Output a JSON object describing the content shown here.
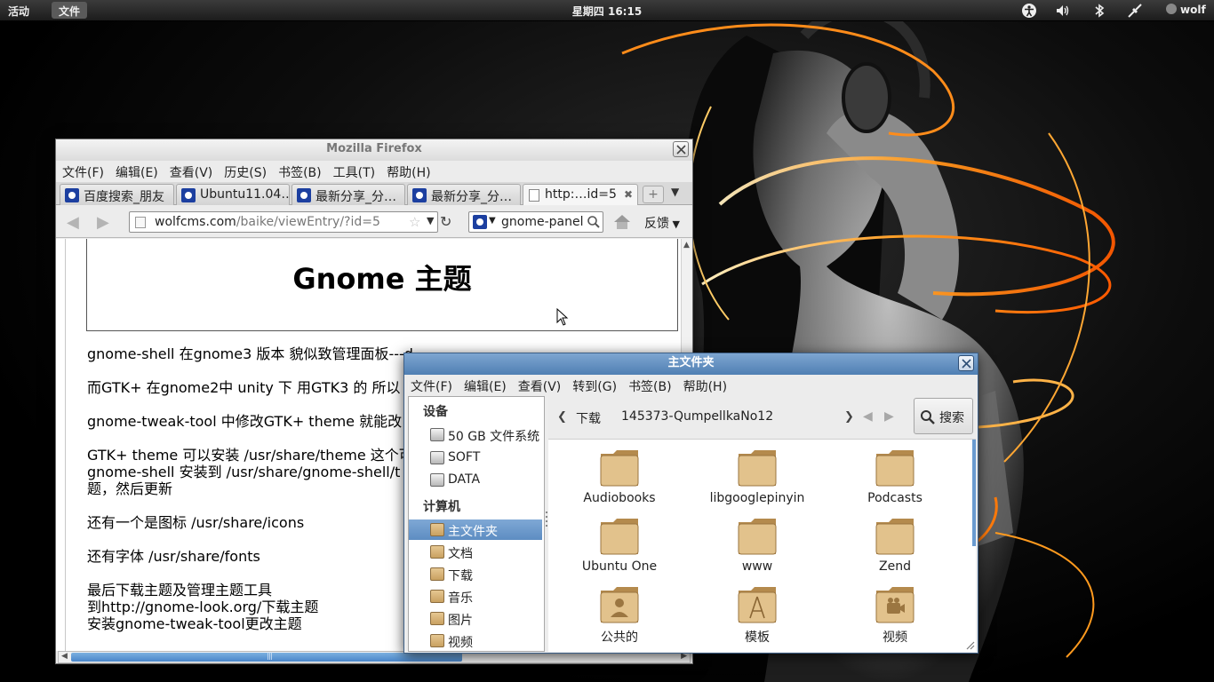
{
  "top_panel": {
    "activities": "活动",
    "app_menu": "文件",
    "clock": "星期四 16:15",
    "user": "wolf",
    "icons": [
      "accessibility-icon",
      "volume-icon",
      "bluetooth-icon",
      "network-icon"
    ]
  },
  "firefox": {
    "title": "Mozilla Firefox",
    "menu": [
      "文件(F)",
      "编辑(E)",
      "查看(V)",
      "历史(S)",
      "书签(B)",
      "工具(T)",
      "帮助(H)"
    ],
    "tabs": [
      {
        "label": "百度搜索_朋友"
      },
      {
        "label": "Ubuntu11.04…"
      },
      {
        "label": "最新分享_分…"
      },
      {
        "label": "最新分享_分…"
      },
      {
        "label": "http:…id=5"
      }
    ],
    "new_tab": "+",
    "url_host": "wolfcms.com",
    "url_path": "/baike/viewEntry/?id=5",
    "search_text": "gnome-panel",
    "feedback_label": "反馈",
    "page_title": "Gnome 主题",
    "paragraphs": [
      "gnome-shell 在gnome3 版本  貌似致管理面板---d",
      "而GTK+ 在gnome2中  unity 下 用GTK3 的 所以",
      "gnome-tweak-tool 中修改GTK+ theme 就能改",
      "GTK+ theme 可以安装 /usr/share/theme 这个可\ngnome-shell 安装到  /usr/share/gnome-shell/t\n题，然后更新",
      "还有一个是图标 /usr/share/icons",
      "还有字体 /usr/share/fonts",
      "最后下载主题及管理主题工具\n到http://gnome-look.org/下载主题\n安装gnome-tweak-tool更改主题"
    ]
  },
  "nautilus": {
    "title": "主文件夹",
    "menu": [
      "文件(F)",
      "编辑(E)",
      "查看(V)",
      "转到(G)",
      "书签(B)",
      "帮助(H)"
    ],
    "sidebar": {
      "devices_header": "设备",
      "devices": [
        "50 GB 文件系统",
        "SOFT",
        "DATA"
      ],
      "computer_header": "计算机",
      "places": [
        "主文件夹",
        "文档",
        "下载",
        "音乐",
        "图片",
        "视频"
      ]
    },
    "path": [
      "下载",
      "145373-QumpellkaNo12"
    ],
    "search_label": "搜索",
    "files": [
      "Audiobooks",
      "libgooglepinyin",
      "Podcasts",
      "Ubuntu One",
      "www",
      "Zend",
      "公共的",
      "模板",
      "视频"
    ]
  }
}
